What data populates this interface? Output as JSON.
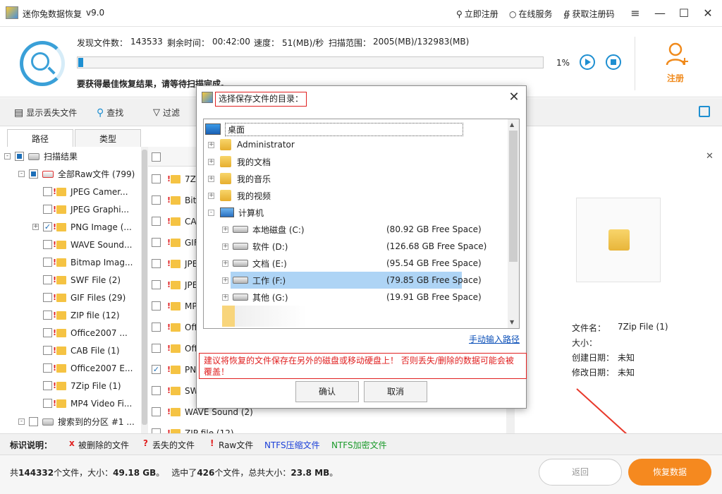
{
  "app": {
    "title": "迷你兔数据恢复",
    "version": "v9.0"
  },
  "titlebar": {
    "register": "立即注册",
    "online_service": "在线服务",
    "get_code": "获取注册码"
  },
  "scan": {
    "found_label": "发现文件数：",
    "found_value": "143533",
    "remain_label": "剩余时间：",
    "remain_value": "00:42:00",
    "speed_label": "速度：",
    "speed_value": "51(MB)/秒",
    "range_label": "扫描范围：",
    "range_value": "2005(MB)/132983(MB)",
    "progress_percent": 1,
    "progress_text": "1%",
    "hint": "要获得最佳恢复结果，请等待扫描完成。"
  },
  "register_label": "注册",
  "toolbar": {
    "show_lost": "显示丢失文件",
    "find": "查找",
    "filter": "过滤"
  },
  "tabs": [
    "路径",
    "类型"
  ],
  "tree": {
    "root": "扫描结果",
    "all_raw": "全部Raw文件 (799)",
    "items": [
      {
        "label": "JPEG Camer...",
        "checked": false
      },
      {
        "label": "JPEG Graphi...",
        "checked": false
      },
      {
        "label": "PNG Image (...",
        "checked": true
      },
      {
        "label": "WAVE Sound...",
        "checked": false
      },
      {
        "label": "Bitmap Imag...",
        "checked": false
      },
      {
        "label": "SWF File (2)",
        "checked": false
      },
      {
        "label": "GIF Files (29)",
        "checked": false
      },
      {
        "label": "ZIP file (12)",
        "checked": false
      },
      {
        "label": "Office2007 ...",
        "checked": false
      },
      {
        "label": "CAB File (1)",
        "checked": false
      },
      {
        "label": "Office2007 E...",
        "checked": false
      },
      {
        "label": "7Zip File (1)",
        "checked": false
      },
      {
        "label": "MP4 Video Fi...",
        "checked": false
      }
    ],
    "partition": "搜索到的分区 #1 ..."
  },
  "files": [
    {
      "label": "7Zip",
      "checked": false
    },
    {
      "label": "Bitm",
      "checked": false
    },
    {
      "label": "CAB",
      "checked": false
    },
    {
      "label": "GIF",
      "checked": false
    },
    {
      "label": "JPE",
      "checked": false
    },
    {
      "label": "JPE",
      "checked": false
    },
    {
      "label": "MP4",
      "checked": false
    },
    {
      "label": "Offi",
      "checked": false
    },
    {
      "label": "Offi",
      "checked": false
    },
    {
      "label": "PNG",
      "checked": true
    },
    {
      "label": "SWF",
      "checked": false
    },
    {
      "label": "WAVE Sound (2)",
      "checked": false
    },
    {
      "label": "ZIP file (12)",
      "checked": false
    }
  ],
  "preview": {
    "name_label": "文件名：",
    "name_value": "7Zip File (1)",
    "size_label": "大小：",
    "size_value": "",
    "created_label": "创建日期：",
    "created_value": "未知",
    "modified_label": "修改日期：",
    "modified_value": "未知"
  },
  "legend": {
    "title": "标识说明：",
    "deleted": "被删除的文件",
    "lost": "丢失的文件",
    "raw": "Raw文件",
    "ntfs_compressed": "NTFS压缩文件",
    "ntfs_encrypted": "NTFS加密文件",
    "deleted_mark": "x",
    "lost_mark": "?",
    "raw_mark": "!"
  },
  "status": {
    "total_prefix": "共",
    "total_count": "144332",
    "total_mid": "个文件，大小：",
    "total_size": "49.18 GB",
    "total_end": "。",
    "sel_prefix": "选中了",
    "sel_count": "426",
    "sel_mid": "个文件，总共大小：",
    "sel_size": "23.8 MB",
    "sel_end": "。"
  },
  "buttons": {
    "back": "返回",
    "recover": "恢复数据"
  },
  "dialog": {
    "title": "选择保存文件的目录：",
    "desktop": "桌面",
    "nodes": [
      {
        "label": "Administrator",
        "free": ""
      },
      {
        "label": "我的文档",
        "free": ""
      },
      {
        "label": "我的音乐",
        "free": ""
      },
      {
        "label": "我的视频",
        "free": ""
      },
      {
        "label": "计算机",
        "free": ""
      }
    ],
    "drives": [
      {
        "label": "本地磁盘 (C:)",
        "free": "(80.92 GB Free Space)"
      },
      {
        "label": "软件 (D:)",
        "free": "(126.68 GB Free Space)"
      },
      {
        "label": "文档 (E:)",
        "free": "(95.54 GB Free Space)"
      },
      {
        "label": "工作 (F:)",
        "free": "(79.85 GB Free Space)"
      },
      {
        "label": "其他 (G:)",
        "free": "(19.91 GB Free Space)"
      }
    ],
    "manual": "手动输入路径",
    "warning": "建议将恢复的文件保存在另外的磁盘或移动硬盘上！ 否则丢失/删除的数据可能会被覆盖！",
    "ok": "确认",
    "cancel": "取消"
  },
  "colors": {
    "accent": "#1e8fd1",
    "orange": "#f5891f",
    "warn_red": "#e02020",
    "selection": "#aed4f5",
    "ntfs_blue": "#1a3fd8",
    "ntfs_green": "#1a9a2a"
  }
}
